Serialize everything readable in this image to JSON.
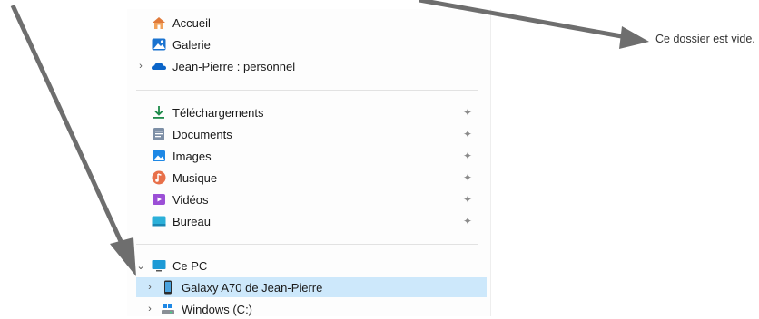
{
  "nav": {
    "quick": [
      {
        "label": "Accueil",
        "icon": "home-icon",
        "expandable": false
      },
      {
        "label": "Galerie",
        "icon": "gallery-icon",
        "expandable": false
      },
      {
        "label": "Jean-Pierre : personnel",
        "icon": "onedrive-cloud-icon",
        "expandable": true
      }
    ],
    "pinned": [
      {
        "label": "Téléchargements",
        "icon": "download-icon"
      },
      {
        "label": "Documents",
        "icon": "documents-icon"
      },
      {
        "label": "Images",
        "icon": "images-icon"
      },
      {
        "label": "Musique",
        "icon": "music-icon"
      },
      {
        "label": "Vidéos",
        "icon": "videos-icon"
      },
      {
        "label": "Bureau",
        "icon": "desktop-folder-icon"
      }
    ],
    "pc": {
      "label": "Ce PC",
      "children": [
        {
          "label": "Galaxy A70 de Jean-Pierre",
          "icon": "phone-icon",
          "selected": true
        },
        {
          "label": "Windows (C:)",
          "icon": "drive-icon",
          "selected": false
        }
      ]
    }
  },
  "content": {
    "empty_message": "Ce dossier est vide."
  },
  "colors": {
    "selection": "#cde8fb",
    "arrow": "#6e6e6e"
  }
}
